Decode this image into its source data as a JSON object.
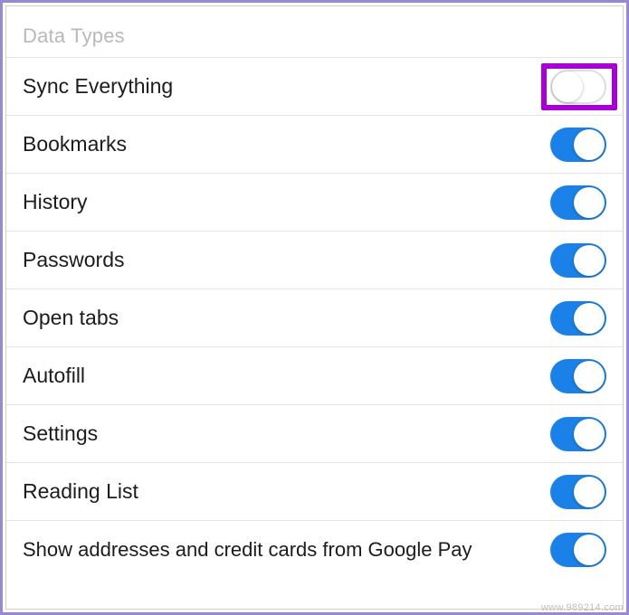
{
  "section_title": "Data Types",
  "items": [
    {
      "id": "sync-everything",
      "label": "Sync Everything",
      "state": "off",
      "highlighted": true
    },
    {
      "id": "bookmarks",
      "label": "Bookmarks",
      "state": "on",
      "highlighted": false
    },
    {
      "id": "history",
      "label": "History",
      "state": "on",
      "highlighted": false
    },
    {
      "id": "passwords",
      "label": "Passwords",
      "state": "on",
      "highlighted": false
    },
    {
      "id": "open-tabs",
      "label": "Open tabs",
      "state": "on",
      "highlighted": false
    },
    {
      "id": "autofill",
      "label": "Autofill",
      "state": "on",
      "highlighted": false
    },
    {
      "id": "settings",
      "label": "Settings",
      "state": "on",
      "highlighted": false
    },
    {
      "id": "reading-list",
      "label": "Reading List",
      "state": "on",
      "highlighted": false
    },
    {
      "id": "google-pay",
      "label": "Show addresses and credit cards from Google Pay",
      "state": "on",
      "highlighted": false
    }
  ],
  "colors": {
    "frame_border": "#9788d8",
    "toggle_on": "#1a81e8",
    "highlight": "#a700d4"
  },
  "watermark": "www.989214.com"
}
